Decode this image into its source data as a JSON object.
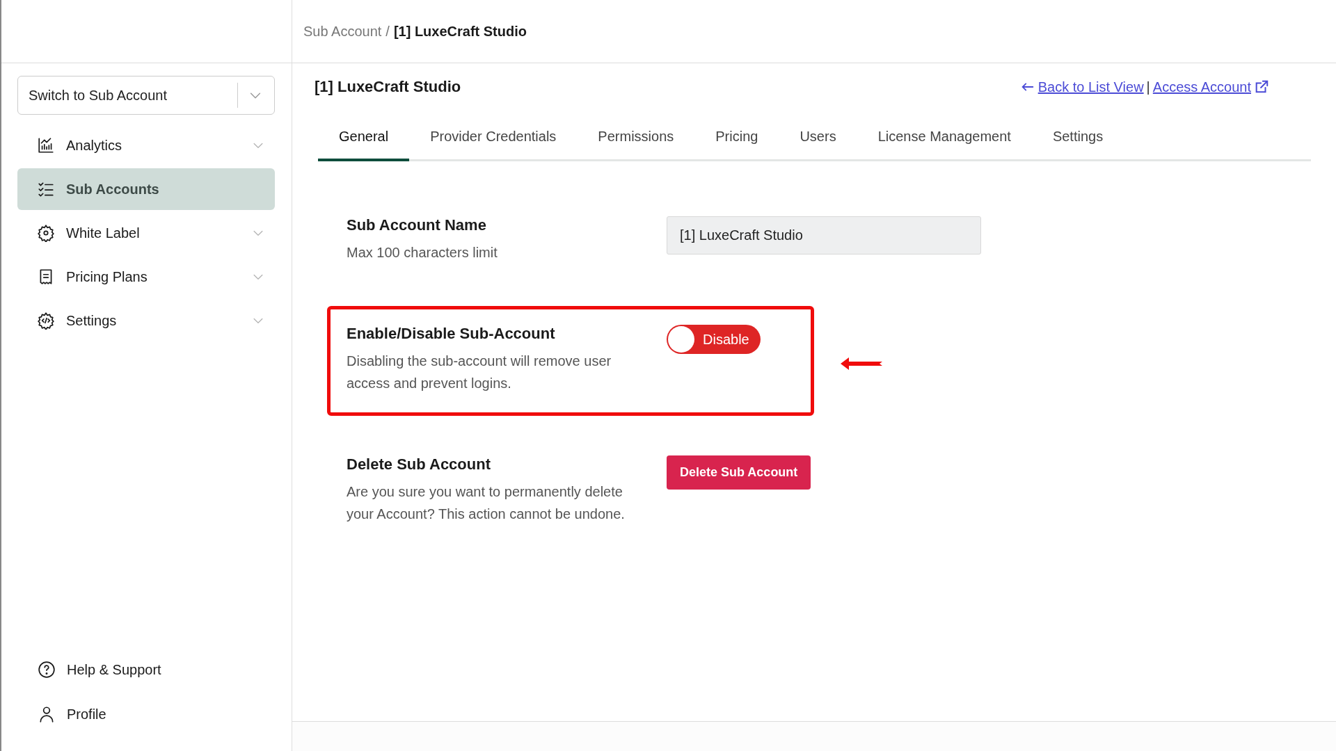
{
  "breadcrumb": {
    "parent": "Sub Account",
    "separator": "/",
    "current": "[1] LuxeCraft Studio"
  },
  "sidebar": {
    "switcher": {
      "placeholder": "Switch to Sub Account"
    },
    "items": [
      {
        "label": "Analytics",
        "selected": false,
        "expandable": true
      },
      {
        "label": "Sub Accounts",
        "selected": true,
        "expandable": false
      },
      {
        "label": "White Label",
        "selected": false,
        "expandable": true
      },
      {
        "label": "Pricing Plans",
        "selected": false,
        "expandable": true
      },
      {
        "label": "Settings",
        "selected": false,
        "expandable": true
      }
    ],
    "footer": [
      {
        "label": "Help & Support"
      },
      {
        "label": "Profile"
      }
    ]
  },
  "page": {
    "title": "[1] LuxeCraft Studio",
    "links": [
      {
        "label": "Back to List View"
      },
      {
        "label": "Access Account"
      }
    ],
    "link_separator": "|",
    "tabs": [
      {
        "label": "General",
        "selected": true
      },
      {
        "label": "Provider Credentials",
        "selected": false
      },
      {
        "label": "Permissions",
        "selected": false
      },
      {
        "label": "Pricing",
        "selected": false
      },
      {
        "label": "Users",
        "selected": false
      },
      {
        "label": "License Management",
        "selected": false
      },
      {
        "label": "Settings",
        "selected": false
      }
    ],
    "sections": [
      {
        "kind": "field",
        "title": "Sub Account Name",
        "description": "Max 100 characters limit",
        "value": "[1] LuxeCraft Studio"
      },
      {
        "kind": "toggle",
        "title": "Enable/Disable Sub-Account",
        "description": "Disabling the sub-account will remove user access and prevent logins.",
        "toggle": {
          "on": false,
          "label": "Disable"
        },
        "highlighted": true
      },
      {
        "kind": "button",
        "title": "Delete Sub Account",
        "description": "Are you sure you want to permanently delete your Account? This action cannot be undone.",
        "button": "Delete Sub Account"
      }
    ]
  }
}
